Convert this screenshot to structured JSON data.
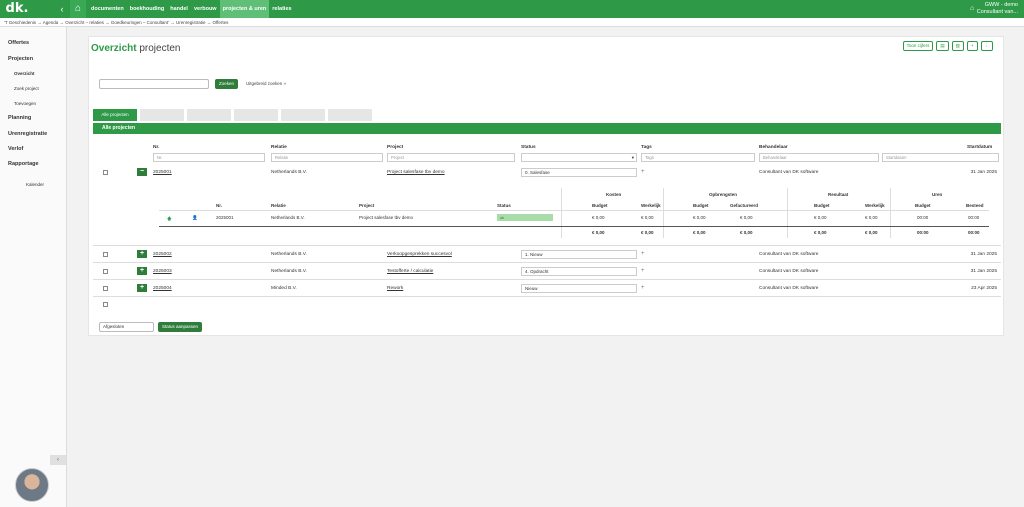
{
  "topbar": {
    "logo": "dk.",
    "nav": [
      "documenten",
      "boekhouding",
      "handel",
      "verbouw",
      "projecten & uren",
      "relaties"
    ],
    "active_index": 4,
    "user_line1": "GWW - demo",
    "user_line2": "Consultant van..."
  },
  "breadcrumb": "'T Geschiedenis → Agenda → Overzicht – relaties → Goedkeuringen – Consultant' → Urenregistratie → Offertes",
  "sidebar": {
    "items": [
      "Offertes",
      "Projecten",
      "Planning",
      "Urenregistratie",
      "Verlof",
      "Rapportage"
    ],
    "subitems": [
      "Overzicht",
      "Zoek project",
      "Toevoegen"
    ],
    "extra": "Kalender"
  },
  "page": {
    "title_bold": "Overzicht",
    "title_rest": " projecten",
    "top_buttons": [
      "Toon cijfers",
      "▤",
      "▥",
      "+",
      "⋮"
    ],
    "search_placeholder": "",
    "search_button": "Zoeken",
    "advanced_link": "Uitgebreid zoeken »",
    "tabs": [
      "Alle projecten",
      "",
      "",
      "",
      "",
      ""
    ],
    "section_title": "Alle projecten"
  },
  "table": {
    "headers": {
      "nr": "Nr.",
      "relatie": "Relatie",
      "project": "Project",
      "status": "Status",
      "tags": "Tags",
      "behandelaar": "Behandelaar",
      "startdatum": "Startdatum"
    },
    "filters": {
      "nr": "Nr.",
      "relatie": "Relatie",
      "project": "Project",
      "tags": "Tags",
      "behandelaar": "Behandelaar",
      "startdatum": "Startdatum"
    },
    "rows": [
      {
        "nr": "2025001",
        "relatie": "Netherlands B.V.",
        "project": "Project salesfase tbv demo",
        "status": "0. Salesfase",
        "behandelaar": "Consultant van DK software",
        "startdatum": "31 Jan 2025",
        "toggle": "−"
      },
      {
        "nr": "2025002",
        "relatie": "Netherlands B.V.",
        "project": "Verkoopgesprekken succesvol",
        "status": "1. Nieuw",
        "behandelaar": "Consultant van DK software",
        "startdatum": "31 Jan 2025",
        "toggle": "+"
      },
      {
        "nr": "2025003",
        "relatie": "Netherlands B.V.",
        "project": "Testofferte / calculatie",
        "status": "4. Opdracht",
        "behandelaar": "Consultant van DK software",
        "startdatum": "31 Jan 2025",
        "toggle": "+"
      },
      {
        "nr": "2025004",
        "relatie": "Minded B.V.",
        "project": "Rework",
        "status": "Nieuw",
        "behandelaar": "Consultant van DK software",
        "startdatum": "23 Apr 2025",
        "toggle": "+"
      }
    ],
    "tag_plus": "+"
  },
  "subtable": {
    "groups": [
      "Kosten",
      "Opbrengsten",
      "Resultaat",
      "Uren"
    ],
    "cols": [
      "Nr.",
      "Relatie",
      "Project",
      "Status",
      "Budget",
      "Werkelijk",
      "Budget",
      "Gefactureerd",
      "Budget",
      "Werkelijk",
      "Budget",
      "Besteed"
    ],
    "row": {
      "nr": "2025001",
      "relatie": "Netherlands B.V.",
      "project": "Project salesfase tbv demo",
      "status": "ok",
      "values": [
        "€ 0,00",
        "€ 0,00",
        "€ 0,00",
        "€ 0,00",
        "€ 0,00",
        "€ 0,00",
        "00:00",
        "00:00"
      ]
    },
    "totals": [
      "€ 0,00",
      "€ 0,00",
      "€ 0,00",
      "€ 0,00",
      "€ 0,00",
      "€ 0,00",
      "00:00",
      "00:00"
    ]
  },
  "footer": {
    "select_value": "Afgesloten",
    "button": "Status aanpassen"
  }
}
